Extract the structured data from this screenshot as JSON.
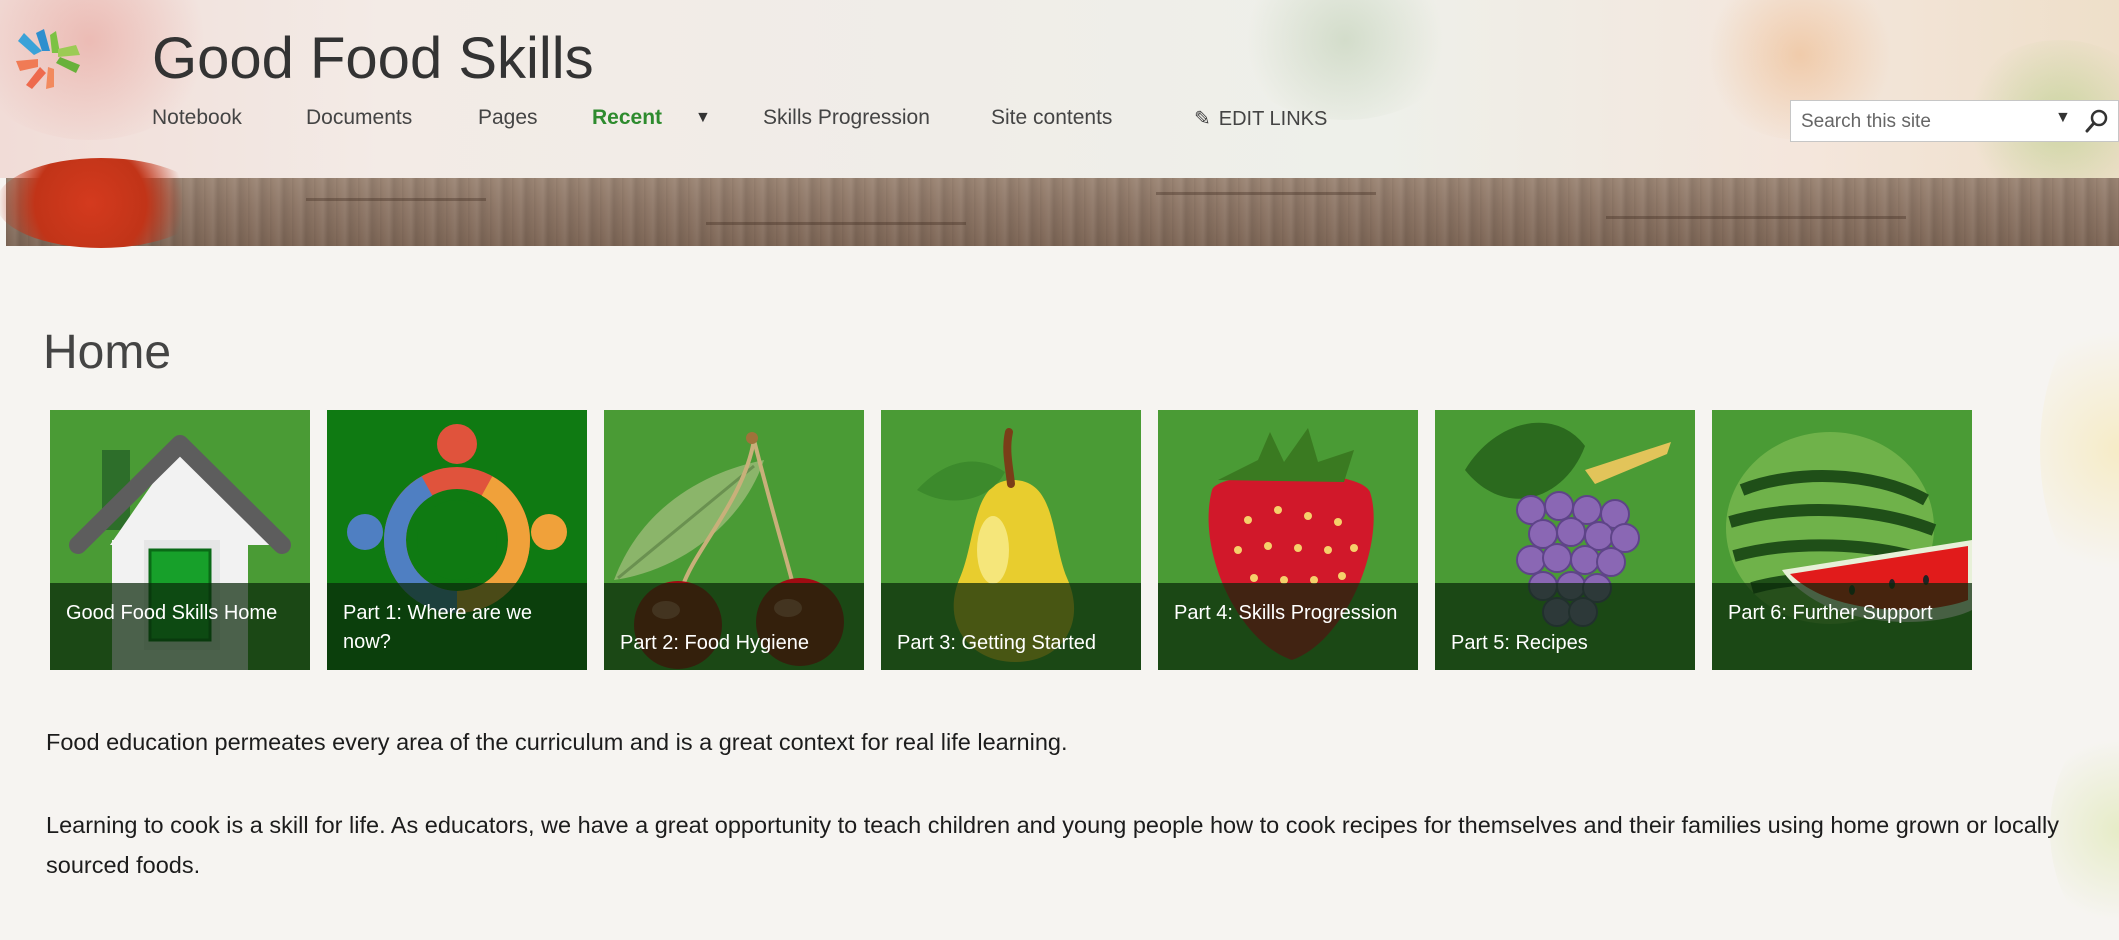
{
  "header": {
    "site_title": "Good Food Skills",
    "nav": [
      {
        "label": "Notebook"
      },
      {
        "label": "Documents"
      },
      {
        "label": "Pages"
      },
      {
        "label": "Recent"
      },
      {
        "label": "Skills Progression"
      },
      {
        "label": "Site contents"
      }
    ],
    "edit_links": "EDIT LINKS",
    "search_placeholder": "Search this site"
  },
  "main": {
    "page_title": "Home",
    "tiles": [
      {
        "label": "Good Food Skills Home",
        "icon": "house-icon"
      },
      {
        "label": "Part 1: Where are we now?",
        "icon": "people-circle-icon"
      },
      {
        "label": "Part 2: Food Hygiene",
        "icon": "cherries-icon"
      },
      {
        "label": "Part 3: Getting Started",
        "icon": "pear-icon"
      },
      {
        "label": "Part 4: Skills Progression",
        "icon": "strawberry-icon"
      },
      {
        "label": "Part 5: Recipes",
        "icon": "grapes-icon"
      },
      {
        "label": "Part 6: Further Support",
        "icon": "watermelon-icon"
      }
    ],
    "paragraphs": [
      "Food education permeates every area of the curriculum and is a great context for real life learning.",
      "Learning to cook is a skill for life. As educators, we have a great opportunity to teach children and young people how to cook recipes for themselves and their families using home grown or locally sourced foods."
    ]
  },
  "colors": {
    "accent_green": "#2e8b2e",
    "tile_green": "#4a9b35",
    "tile_dark_green": "#0f7a12"
  }
}
